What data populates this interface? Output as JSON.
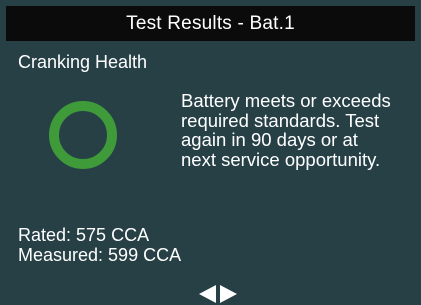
{
  "header": {
    "title": "Test Results - Bat.1"
  },
  "result": {
    "section_title": "Cranking Health",
    "status_icon": "ring-good-icon",
    "status_color": "#3f9a3a",
    "message": "Battery meets or exceeds\nrequired standards. Test\nagain in 90 days or at\nnext service opportunity."
  },
  "measurements": {
    "rated": "Rated: 575 CCA",
    "measured": "Measured: 599 CCA"
  },
  "navigation": {
    "prev_icon": "arrow-left-icon",
    "next_icon": "arrow-right-icon"
  },
  "colors": {
    "background": "#264046",
    "header_background": "#0b0b0b",
    "text": "#ffffff"
  }
}
